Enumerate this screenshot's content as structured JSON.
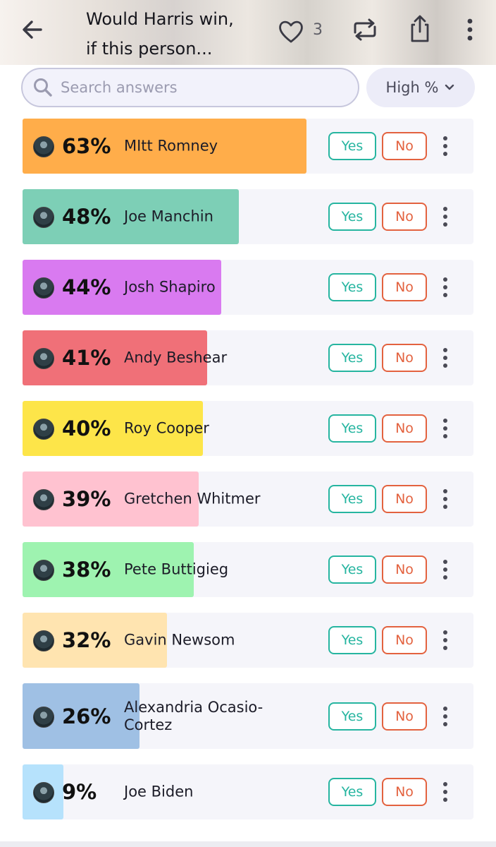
{
  "header": {
    "title_line1": "Would Harris win,",
    "title_line2": "if this person...",
    "like_count": "3",
    "icons": {
      "back": "arrow-left-icon",
      "like": "heart-icon",
      "repost": "repost-icon",
      "share": "share-icon",
      "more": "more-vertical-icon"
    }
  },
  "search": {
    "placeholder": "Search answers",
    "value": ""
  },
  "sort": {
    "label": "High %"
  },
  "actions": {
    "yes": "Yes",
    "no": "No"
  },
  "answers": [
    {
      "pct_label": "63%",
      "pct": 63,
      "name": "MItt Romney",
      "color": "#FFAD4A"
    },
    {
      "pct_label": "48%",
      "pct": 48,
      "name": "Joe Manchin",
      "color": "#7DCFB6"
    },
    {
      "pct_label": "44%",
      "pct": 44,
      "name": "Josh Shapiro",
      "color": "#D97AF0"
    },
    {
      "pct_label": "41%",
      "pct": 41,
      "name": "Andy Beshear",
      "color": "#F07078"
    },
    {
      "pct_label": "40%",
      "pct": 40,
      "name": "Roy Cooper",
      "color": "#FDE549"
    },
    {
      "pct_label": "39%",
      "pct": 39,
      "name": "Gretchen Whitmer",
      "color": "#FFC2D0"
    },
    {
      "pct_label": "38%",
      "pct": 38,
      "name": "Pete Buttigieg",
      "color": "#9EF3B0"
    },
    {
      "pct_label": "32%",
      "pct": 32,
      "name": "Gavin Newsom",
      "color": "#FFE4B0"
    },
    {
      "pct_label": "26%",
      "pct": 26,
      "name": "Alexandria Ocasio-Cortez",
      "color": "#9FC0E4"
    },
    {
      "pct_label": "9%",
      "pct": 9,
      "name": "Joe Biden",
      "color": "#B6E2FC"
    }
  ]
}
